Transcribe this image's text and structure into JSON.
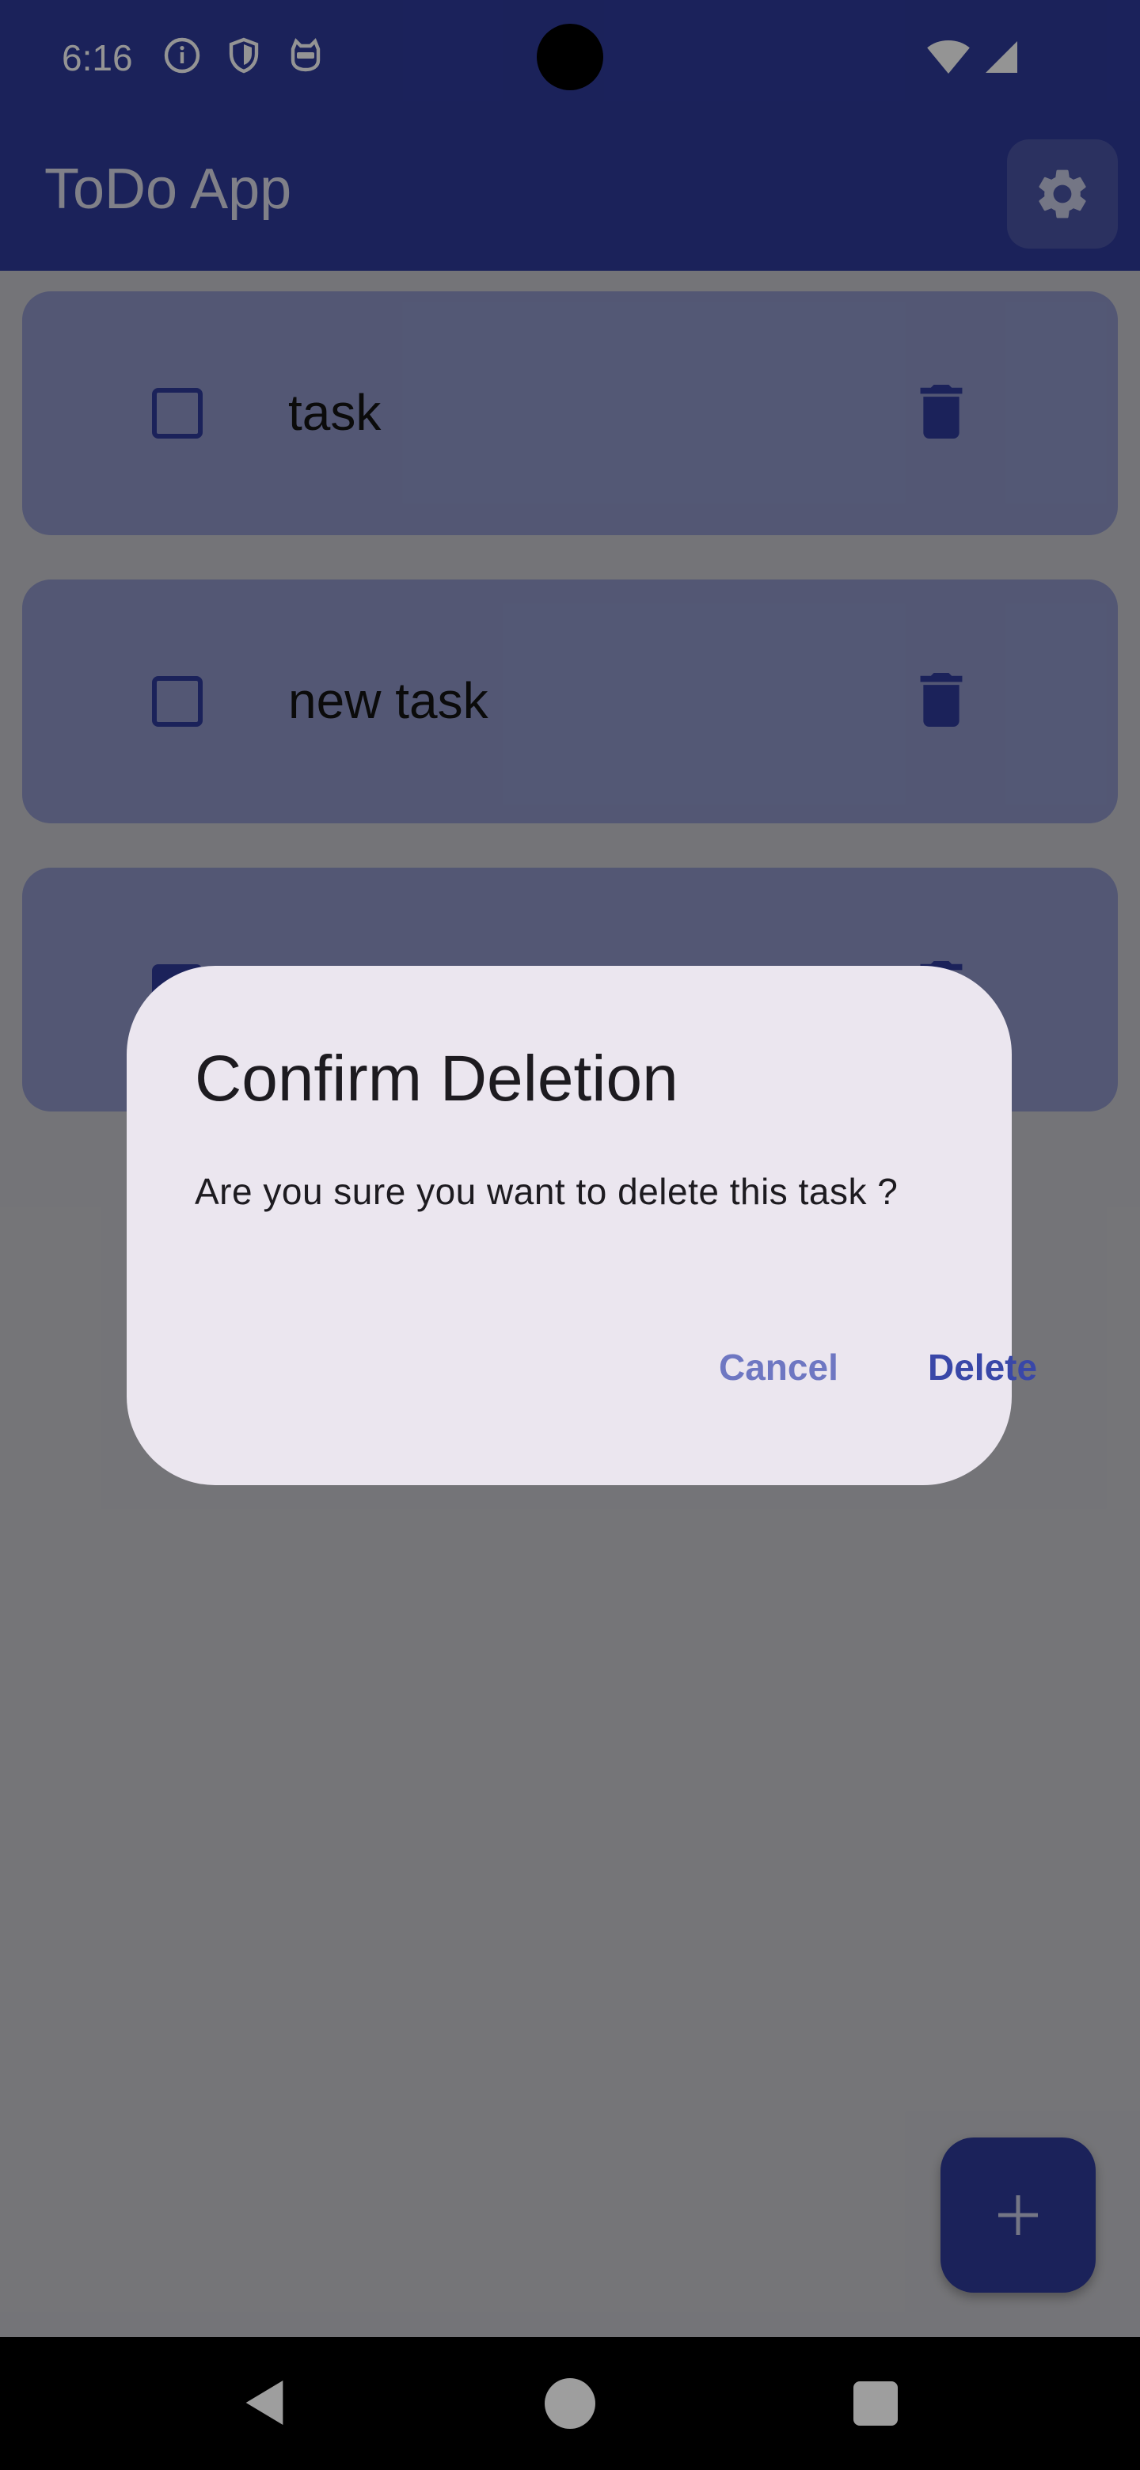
{
  "status_bar": {
    "time": "6:16",
    "left_icons": [
      "info-icon",
      "shield-icon",
      "cat-icon"
    ],
    "right_icons": [
      "wifi-icon",
      "signal-icon"
    ]
  },
  "app_bar": {
    "title": "ToDo App",
    "settings_icon": "gear-icon"
  },
  "tasks": [
    {
      "label": "task",
      "checked": false
    },
    {
      "label": "new task",
      "checked": false
    },
    {
      "label": "",
      "checked": true
    }
  ],
  "dialog": {
    "title": "Confirm Deletion",
    "message": "Are you sure you want to delete this task ?",
    "cancel_label": "Cancel",
    "delete_label": "Delete"
  },
  "fab": {
    "icon": "plus-icon"
  },
  "colors": {
    "primary": "#2f3b9c",
    "card": "#8f97c9",
    "dialog_bg": "#ebe6ef",
    "cancel_text": "#6e77c2",
    "delete_text": "#3947a8"
  }
}
